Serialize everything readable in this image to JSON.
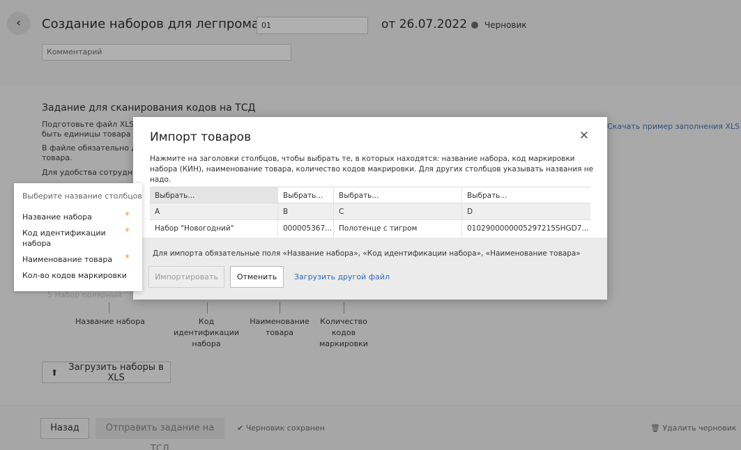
{
  "header": {
    "title": "Создание наборов для легпрома №",
    "number_value": "01",
    "date": "от 26.07.2022",
    "status": "Черновик",
    "comment_placeholder": "Комментарий"
  },
  "task": {
    "title": "Задание для сканирования кодов на ТСД",
    "text_line1": "Подготовьте файл XLS со",
    "text_line2": "быть единицы товара и ко",
    "text_line3": "В файле обязательно дол",
    "text_line4": "товара.",
    "text_line5": "Для удобства сотрудника",
    "download_link": "Скачать пример заполнения XLS",
    "faded_row": "5     Набор полярный",
    "diagram_labels": [
      "Название набора",
      "Код идентификации набора",
      "Наименование товара",
      "Количество кодов маркировки"
    ],
    "upload_button": "Загрузить наборы в XLS"
  },
  "footer": {
    "back_button": "Назад",
    "send_button": "Отправить задание на ТСД",
    "saved_status": "Черновик сохранен",
    "delete_draft": "Удалить черновик"
  },
  "dropdown": {
    "header": "Выберите название столбцов",
    "items": [
      {
        "label": "Название набора",
        "required": true
      },
      {
        "label": "Код идентификации набора",
        "required": true
      },
      {
        "label": "Наименование товара",
        "required": true
      },
      {
        "label": "Кол-во кодов маркировки",
        "required": false
      }
    ]
  },
  "modal": {
    "title": "Импорт товаров",
    "description": "Нажмите на заголовки столбцов, чтобы выбрать те, в которых находятся: название набора, код маркировки набора (КИН), наименование товара, количество кодов макрировки. Для других столбцов указывать названия не надо.",
    "table": {
      "select_labels": [
        "Выбрать...",
        "Выбрать...",
        "Выбрать...",
        "Выбрать..."
      ],
      "letters": [
        "A",
        "B",
        "C",
        "D"
      ],
      "row": [
        "Набор \"Новогодний\"",
        "000005367...",
        "Полотенце с тигром",
        "0102900000005297215SHGD7g7..."
      ]
    },
    "footer_note": "Для импорта обязательные поля «Название набора», «Код идентификации набора», «Наименование товара»",
    "import_button": "Импортировать",
    "cancel_button": "Отменить",
    "load_other_link": "Загрузить другой файл"
  }
}
